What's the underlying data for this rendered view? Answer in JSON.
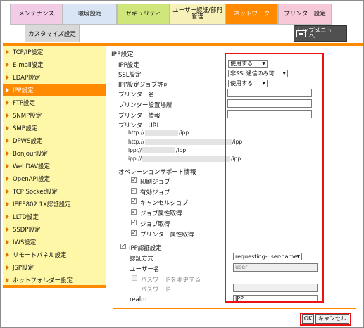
{
  "tabs": {
    "maintenance": "メンテナンス",
    "environment": "環境設定",
    "security": "セキュリティ",
    "user_auth_line1": "ユーザー認証/部門",
    "user_auth_line2": "管理",
    "network": "ネットワーク",
    "printer": "プリンター設定"
  },
  "subtab": "カスタマイズ設定",
  "top_menu_line1": "トップメニュー",
  "top_menu_line2": "へ",
  "sidebar": {
    "items": [
      {
        "label": "TCP/IP設定"
      },
      {
        "label": "E-mail設定"
      },
      {
        "label": "LDAP設定"
      },
      {
        "label": "IPP設定"
      },
      {
        "label": "FTP設定"
      },
      {
        "label": "SNMP設定"
      },
      {
        "label": "SMB設定"
      },
      {
        "label": "DPWS設定"
      },
      {
        "label": "Bonjour設定"
      },
      {
        "label": "WebDAV設定"
      },
      {
        "label": "OpenAPI設定"
      },
      {
        "label": "TCP Socket設定"
      },
      {
        "label": "IEEE802.1X認証設定"
      },
      {
        "label": "LLTD設定"
      },
      {
        "label": "SSDP設定"
      },
      {
        "label": "IWS設定"
      },
      {
        "label": "リモートパネル設定"
      },
      {
        "label": "JSP設定"
      },
      {
        "label": "ホットフォルダー設定"
      }
    ]
  },
  "main": {
    "title": "IPP設定",
    "ipp_setting_label": "IPP設定",
    "ipp_setting_value": "使用する",
    "ssl_label": "SSL設定",
    "ssl_value": "非SSL通信のみ可",
    "ipp_job_label": "IPP設定ジョブ許可",
    "ipp_job_value": "使用する",
    "printer_name_label": "プリンター名",
    "printer_location_label": "プリンター設置場所",
    "printer_info_label": "プリンター情報",
    "printer_uri_label": "プリンターURI",
    "uri1_prefix": "http://",
    "uri1_suffix": "/ipp",
    "uri2_prefix": "http://",
    "uri2_suffix": "/ipp",
    "uri3_prefix": "ipp://",
    "uri3_suffix": "/ipp",
    "uri4_prefix": "ipp://",
    "uri4_suffix": "/ipp",
    "ops_label": "オペレーションサポート情報",
    "ops": [
      {
        "label": "印刷ジョブ"
      },
      {
        "label": "有効ジョブ"
      },
      {
        "label": "キャンセルジョブ"
      },
      {
        "label": "ジョブ属性取得"
      },
      {
        "label": "ジョブ取得"
      },
      {
        "label": "プリンター属性取得"
      }
    ],
    "ipp_auth_label": "IPP認証設定",
    "auth_method_label": "認証方式",
    "auth_method_value": "requesting-user-name",
    "username_label": "ユーザー名",
    "username_value": "user",
    "change_pw_label": "パスワードを変更する",
    "password_label": "パスワード",
    "realm_label": "realm",
    "realm_value": "IPP"
  },
  "buttons": {
    "ok": "OK",
    "cancel": "キャンセル"
  }
}
